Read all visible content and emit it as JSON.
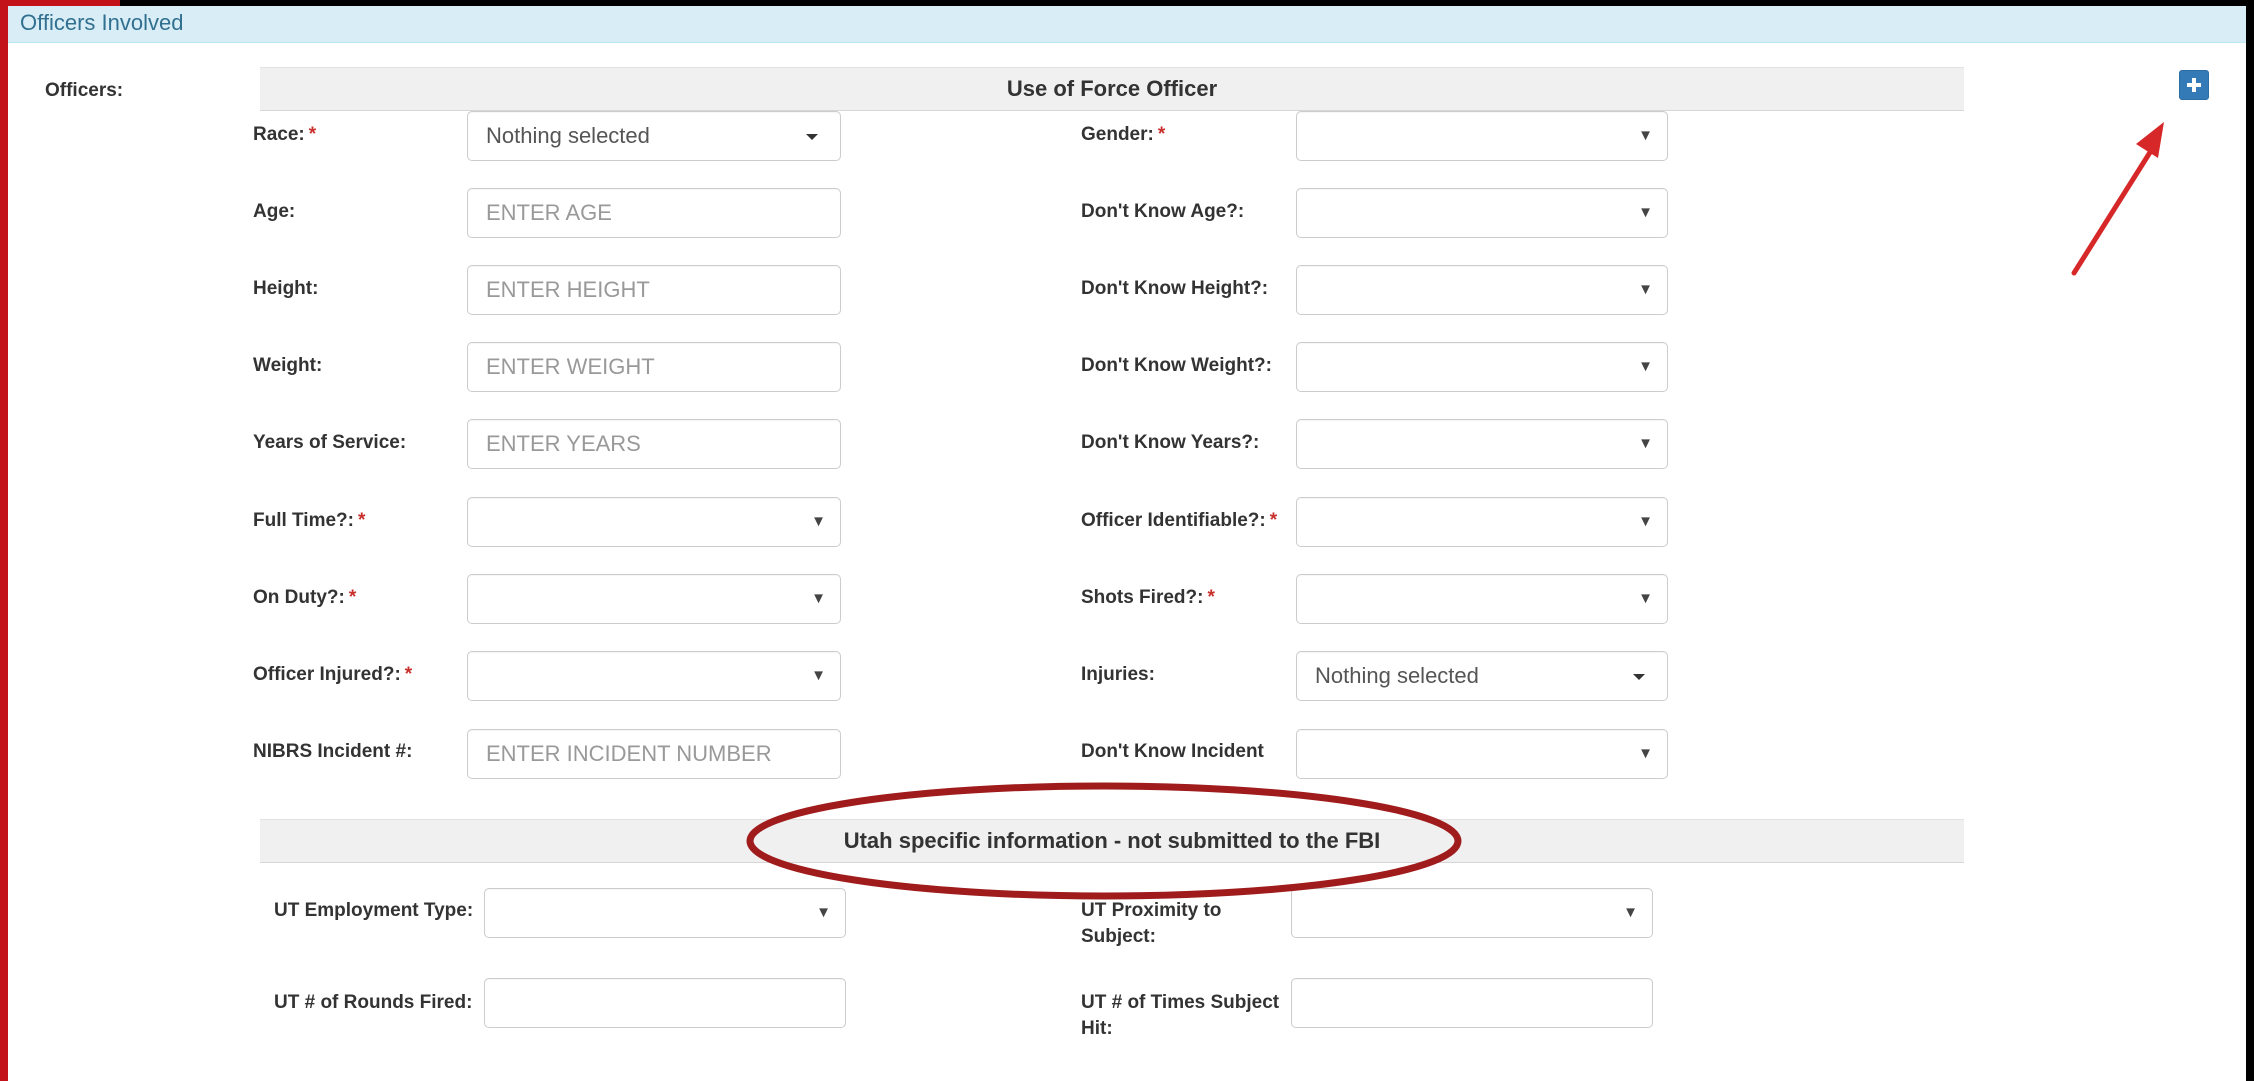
{
  "panel": {
    "title": "Officers Involved"
  },
  "officers_label": "Officers:",
  "section_uof": {
    "title": "Use of Force Officer"
  },
  "section_ut": {
    "title": "Utah specific information - not submitted to the FBI"
  },
  "fields": {
    "race": {
      "label": "Race:",
      "value": "Nothing selected"
    },
    "gender": {
      "label": "Gender:",
      "value": ""
    },
    "age": {
      "label": "Age:",
      "placeholder": "ENTER AGE"
    },
    "dk_age": {
      "label": "Don't Know Age?:",
      "value": ""
    },
    "height": {
      "label": "Height:",
      "placeholder": "ENTER HEIGHT"
    },
    "dk_height": {
      "label": "Don't Know Height?:",
      "value": ""
    },
    "weight": {
      "label": "Weight:",
      "placeholder": "ENTER WEIGHT"
    },
    "dk_weight": {
      "label": "Don't Know Weight?:",
      "value": ""
    },
    "years": {
      "label": "Years of Service:",
      "placeholder": "ENTER YEARS"
    },
    "dk_years": {
      "label": "Don't Know Years?:",
      "value": ""
    },
    "full_time": {
      "label": "Full Time?:",
      "value": ""
    },
    "identifiable": {
      "label": "Officer Identifiable?:",
      "value": ""
    },
    "on_duty": {
      "label": "On Duty?:",
      "value": ""
    },
    "shots_fired": {
      "label": "Shots Fired?:",
      "value": ""
    },
    "injured": {
      "label": "Officer Injured?:",
      "value": ""
    },
    "injuries": {
      "label": "Injuries:",
      "value": "Nothing selected"
    },
    "nibrs": {
      "label": "NIBRS Incident #:",
      "placeholder": "ENTER INCIDENT NUMBER"
    },
    "dk_incident": {
      "label": "Don't Know Incident #?:",
      "value": ""
    },
    "ut_employment": {
      "label": "UT Employment Type:",
      "value": ""
    },
    "ut_proximity": {
      "label": "UT Proximity to Subject:",
      "value": ""
    },
    "ut_rounds": {
      "label": "UT # of Rounds Fired:",
      "value": ""
    },
    "ut_times_hit": {
      "label": "UT # of Times Subject Hit:",
      "value": ""
    }
  },
  "required_marker": "*",
  "icons": {
    "add": "plus-icon",
    "caret": "caret-down-icon",
    "arrow": "arrow-annotation"
  },
  "colors": {
    "annotation_red": "#d62828",
    "ellipse_red": "#a01c1c",
    "panel_head": "#d9edf7",
    "button_blue": "#337ab7"
  }
}
